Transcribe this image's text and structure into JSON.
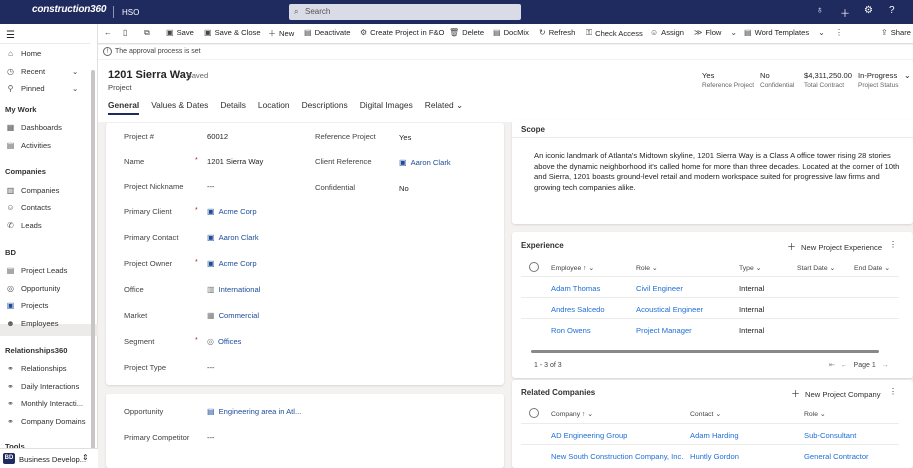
{
  "topbar": {
    "brand": "construction360",
    "app_name": "HSO",
    "search_placeholder": "Search",
    "icons": [
      "lightbulb-icon",
      "plus-icon",
      "gear-icon",
      "help-icon"
    ]
  },
  "command_bar": {
    "items": [
      {
        "label": "Save",
        "icon": "save-icon"
      },
      {
        "label": "Save & Close",
        "icon": "save-close-icon"
      },
      {
        "label": "New",
        "icon": "plus-icon"
      },
      {
        "label": "Deactivate",
        "icon": "deactivate-icon"
      },
      {
        "label": "Create Project in F&O",
        "icon": "create-icon"
      },
      {
        "label": "Delete",
        "icon": "trash-icon"
      },
      {
        "label": "DocMix",
        "icon": "docmix-icon"
      },
      {
        "label": "Refresh",
        "icon": "refresh-icon"
      },
      {
        "label": "Check Access",
        "icon": "key-icon"
      },
      {
        "label": "Assign",
        "icon": "person-icon"
      },
      {
        "label": "Flow",
        "icon": "flow-icon"
      },
      {
        "label": "Word Templates",
        "icon": "word-icon"
      },
      {
        "label": "Share",
        "icon": "share-icon"
      }
    ]
  },
  "notice": {
    "text": "The approval process is set"
  },
  "nav": {
    "top": [
      {
        "label": "Home",
        "icon": "home-icon"
      },
      {
        "label": "Recent",
        "icon": "clock-icon"
      },
      {
        "label": "Pinned",
        "icon": "pin-icon"
      }
    ],
    "sections": [
      {
        "title": "My Work",
        "items": [
          {
            "label": "Dashboards"
          },
          {
            "label": "Activities"
          }
        ]
      },
      {
        "title": "Companies",
        "items": [
          {
            "label": "Companies"
          },
          {
            "label": "Contacts"
          },
          {
            "label": "Leads"
          }
        ]
      },
      {
        "title": "BD",
        "items": [
          {
            "label": "Project Leads"
          },
          {
            "label": "Opportunity"
          },
          {
            "label": "Projects"
          },
          {
            "label": "Employees"
          }
        ]
      },
      {
        "title": "Relationships360",
        "items": [
          {
            "label": "Relationships"
          },
          {
            "label": "Daily Interactions"
          },
          {
            "label": "Monthly Interacti..."
          },
          {
            "label": "Company Domains"
          }
        ]
      },
      {
        "title": "Tools",
        "items": []
      }
    ],
    "area_badge": "BD",
    "area_label": "Business Develop..."
  },
  "record": {
    "title": "1201 Sierra Way",
    "saved_status": "- Saved",
    "entity": "Project",
    "header_fields": [
      {
        "value": "Yes",
        "label": "Reference Project"
      },
      {
        "value": "No",
        "label": "Confidential"
      },
      {
        "value": "$4,311,250.00",
        "label": "Total Contract"
      },
      {
        "value": "In-Progress",
        "label": "Project Status"
      }
    ],
    "tabs": [
      "General",
      "Values & Dates",
      "Details",
      "Location",
      "Descriptions",
      "Digital Images",
      "Related"
    ]
  },
  "general": {
    "project_number_label": "Project #",
    "project_number": "60012",
    "name_label": "Name",
    "name": "1201 Sierra Way",
    "nickname_label": "Project Nickname",
    "nickname": "---",
    "primary_client_label": "Primary Client",
    "primary_client": "Acme Corp",
    "primary_contact_label": "Primary Contact",
    "primary_contact": "Aaron Clark",
    "project_owner_label": "Project Owner",
    "project_owner": "Acme Corp",
    "office_label": "Office",
    "office": "International",
    "market_label": "Market",
    "market": "Commercial",
    "segment_label": "Segment",
    "segment": "Offices",
    "project_type_label": "Project Type",
    "project_type": "---",
    "reference_project_label": "Reference Project",
    "reference_project": "Yes",
    "client_reference_label": "Client Reference",
    "client_reference": "Aaron Clark",
    "confidential_label": "Confidential",
    "confidential": "No",
    "opportunity_label": "Opportunity",
    "opportunity": "Engineering area in Atl...",
    "primary_competitor_label": "Primary Competitor",
    "primary_competitor": "---"
  },
  "scope": {
    "title": "Scope",
    "text": "An iconic landmark of Atlanta's Midtown skyline, 1201 Sierra Way is a Class A office tower rising 28 stories above the dynamic neighborhood it's called home for more than three decades. Located at the corner of 10th and Sierra, 1201 boasts ground-level retail and modern workspace suited for progressive law firms and growing tech companies alike."
  },
  "experience": {
    "title": "Experience",
    "new_label": "New Project Experience",
    "columns": [
      "Employee",
      "Role",
      "Type",
      "Start Date",
      "End Date"
    ],
    "rows": [
      {
        "employee": "Adam Thomas",
        "role": "Civil Engineer",
        "type": "Internal"
      },
      {
        "employee": "Andres Salcedo",
        "role": "Acoustical Engineer",
        "type": "Internal"
      },
      {
        "employee": "Ron Owens",
        "role": "Project Manager",
        "type": "Internal"
      }
    ],
    "record_count": "1 - 3 of 3",
    "page_label": "Page 1"
  },
  "related_companies": {
    "title": "Related Companies",
    "new_label": "New Project Company",
    "columns": [
      "Company",
      "Contact",
      "Role"
    ],
    "rows": [
      {
        "company": "AD Engineering Group",
        "contact": "Adam Harding",
        "role": "Sub-Consultant"
      },
      {
        "company": "New South Construction Company, Inc.",
        "contact": "Huntly Gordon",
        "role": "General Contractor"
      }
    ]
  }
}
